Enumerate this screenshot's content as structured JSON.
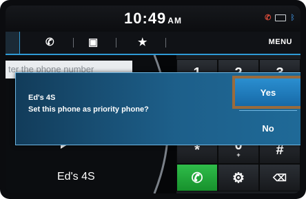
{
  "status_bar": {
    "time": "10:49",
    "ampm": "AM",
    "icons": [
      "phone-signal-icon",
      "battery-icon",
      "bluetooth-icon"
    ]
  },
  "tabs": {
    "items": [
      {
        "name": "call-history-tab",
        "icon": "handset-icon"
      },
      {
        "name": "contacts-tab",
        "icon": "contacts-icon"
      },
      {
        "name": "favorites-tab",
        "icon": "star-icon"
      }
    ],
    "menu_label": "MENU"
  },
  "dialer": {
    "input_placeholder": "ter the phone number",
    "contact_name": "Ed's 4S",
    "keys": [
      {
        "label": "1",
        "sub": ""
      },
      {
        "label": "2",
        "sub": ""
      },
      {
        "label": "3",
        "sub": ""
      },
      {
        "label": "*",
        "sub": ""
      },
      {
        "label": "0",
        "sub": "+"
      },
      {
        "label": "#",
        "sub": ""
      }
    ]
  },
  "dialog": {
    "title": "Ed's 4S",
    "message": "Set this phone as priority phone?",
    "yes_label": "Yes",
    "no_label": "No"
  },
  "colors": {
    "accent": "#2f9bd6",
    "dialog_bg": "#1d5f8a",
    "highlight_frame": "#9a6b3c",
    "call_green": "#2fbd4a"
  }
}
